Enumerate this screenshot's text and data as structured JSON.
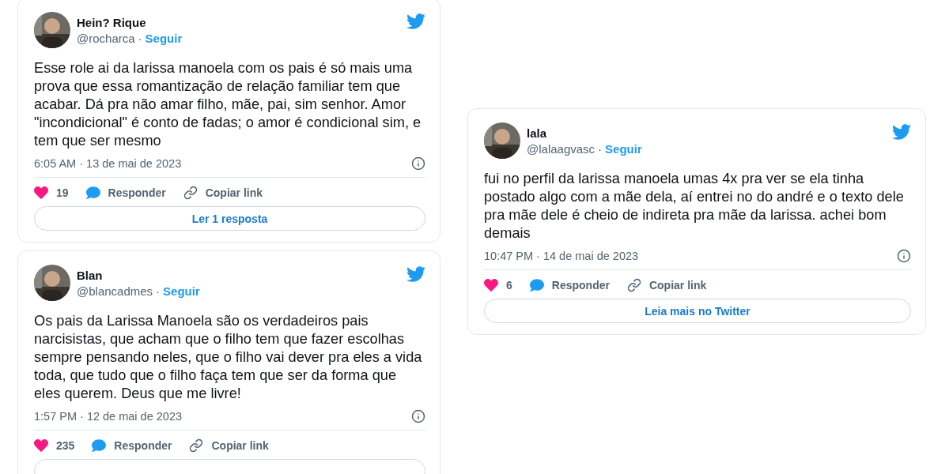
{
  "columns": [
    {
      "tweets": [
        {
          "name": "Hein? Rique",
          "handle": "@rocharca",
          "sep": "·",
          "follow": "Seguir",
          "text": "Esse role ai da larissa manoela com os pais é só mais uma prova que essa romantização de relação familiar tem que acabar. Dá pra não amar filho, mãe, pai, sim senhor. Amor \"incondicional\" é conto de fadas; o amor é condicional sim, e tem que ser mesmo",
          "time": "6:05 AM · 13 de mai de 2023",
          "likes": "19",
          "reply": "Responder",
          "copy": "Copiar link",
          "button": "Ler 1 resposta"
        },
        {
          "name": "Blan",
          "handle": "@blancadmes",
          "sep": "·",
          "follow": "Seguir",
          "text": "Os pais da Larissa Manoela são os verdadeiros pais narcisistas, que acham que o filho tem que fazer escolhas sempre pensando neles, que o filho vai dever pra eles a vida toda, que tudo que o filho faça tem que ser da forma que eles querem. Deus que me livre!",
          "time": "1:57 PM · 12 de mai de 2023",
          "likes": "235",
          "reply": "Responder",
          "copy": "Copiar link"
        }
      ]
    },
    {
      "tweets": [
        {
          "name": "lala",
          "handle": "@lalaagvasc",
          "sep": "·",
          "follow": "Seguir",
          "text": "fui no perfil da larissa manoela umas 4x pra ver se ela tinha postado algo com a mãe dela, aí entrei no do andré e o texto dele pra mãe dele é cheio de indireta pra mãe da larissa. achei bom demais",
          "time": "10:47 PM · 14 de mai de 2023",
          "likes": "6",
          "reply": "Responder",
          "copy": "Copiar link",
          "button": "Leia mais no Twitter"
        }
      ]
    }
  ]
}
